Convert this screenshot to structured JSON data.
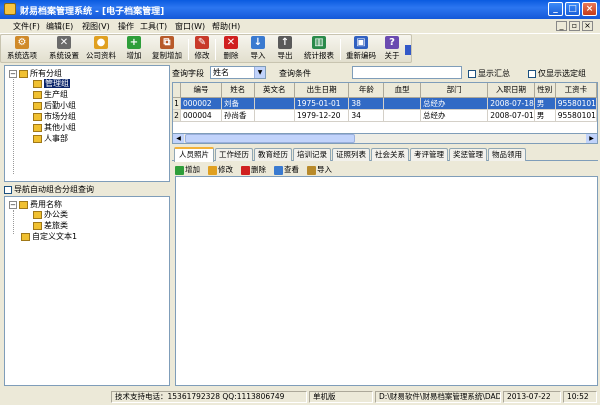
{
  "window": {
    "title": "财易档案管理系统 - [电子档案管理]"
  },
  "menu": [
    "文件(F)",
    "编辑(E)",
    "视图(V)",
    "操作",
    "工具(T)",
    "窗口(W)",
    "帮助(H)"
  ],
  "toolbar": [
    {
      "label": "系统选项",
      "icon": "wrench-icon",
      "color": "#D08A2A"
    },
    {
      "label": "系统设置",
      "icon": "tools-icon",
      "color": "#6A6A6A"
    },
    {
      "label": "公司资料",
      "icon": "people-icon",
      "color": "#E0A020"
    },
    {
      "label": "增加",
      "icon": "add-icon",
      "color": "#2E9E3A"
    },
    {
      "label": "复制增加",
      "icon": "copy-add-icon",
      "color": "#B85A2A"
    },
    {
      "label": "修改",
      "icon": "pencil-icon",
      "color": "#C83A2A"
    },
    {
      "label": "删除",
      "icon": "delete-icon",
      "color": "#D02020"
    },
    {
      "label": "导入",
      "icon": "import-icon",
      "color": "#3A7AD0"
    },
    {
      "label": "导出",
      "icon": "export-icon",
      "color": "#5A5A5A"
    },
    {
      "label": "统计报表",
      "icon": "chart-icon",
      "color": "#2A8A4A"
    },
    {
      "label": "重新编码",
      "icon": "recode-icon",
      "color": "#3060C0"
    },
    {
      "label": "关于",
      "icon": "help-icon",
      "color": "#6A4AB0"
    }
  ],
  "tree": {
    "root": "所有分组",
    "items": [
      "管理组",
      "生产组",
      "后勤小组",
      "市场分组",
      "其他小组",
      "人事部"
    ],
    "selected": "管理组"
  },
  "group_query": {
    "label": "导航自动组合分组查询"
  },
  "tree2": {
    "root": "费用名称",
    "items": [
      "办公类",
      "差旅类"
    ],
    "extra": "自定义文本1"
  },
  "query": {
    "field_label": "查询字段",
    "field_value": "姓名",
    "condition_label": "查询条件",
    "condition_value": "",
    "show_summary": "显示汇总",
    "show_selected_only": "仅显示选定组"
  },
  "grid": {
    "columns": [
      "编号",
      "姓名",
      "英文名",
      "出生日期",
      "年龄",
      "血型",
      "部门",
      "入职日期",
      "性别",
      "工资卡"
    ],
    "rows": [
      {
        "ind": "1",
        "cells": [
          "000002",
          "刘备",
          "",
          "1975-01-01",
          "38",
          "",
          "总经办",
          "2008-07-18",
          "男",
          "95580101"
        ]
      },
      {
        "ind": "2",
        "cells": [
          "000004",
          "孙尚香",
          "",
          "1979-12-20",
          "34",
          "",
          "总经办",
          "2008-07-01",
          "男",
          "95580101"
        ]
      }
    ]
  },
  "tabs": [
    "人员照片",
    "工作经历",
    "教育经历",
    "培训记录",
    "证照列表",
    "社会关系",
    "考评管理",
    "奖惩管理",
    "物品领用"
  ],
  "subtoolbar": [
    "增加",
    "修改",
    "删除",
    "查看",
    "导入"
  ],
  "status": {
    "support": "技术支持电话：15361792328 QQ:1113806749",
    "edition": "单机版",
    "path": "D:\\财易软件\\财易档案管理系统\\DAD",
    "date": "2013-07-22",
    "time": "10:52"
  }
}
